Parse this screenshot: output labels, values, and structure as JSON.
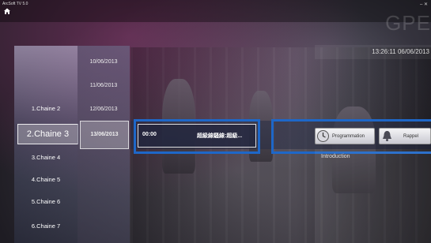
{
  "app": {
    "title": "ArcSoft TV 5.0",
    "brand": "GPE",
    "datetime": "13:26:11   06/06/2013"
  },
  "channels": [
    {
      "label": "1.Chaine 2"
    },
    {
      "label": "2.Chaine 3",
      "selected": true
    },
    {
      "label": "3.Chaine 4"
    },
    {
      "label": "4.Chaine 5"
    },
    {
      "label": "5.Chaine 6"
    },
    {
      "label": "6.Chaine 7"
    }
  ],
  "dates": [
    {
      "label": "10/06/2013"
    },
    {
      "label": "11/06/2013"
    },
    {
      "label": "12/06/2013"
    },
    {
      "label": "13/06/2013",
      "selected": true
    }
  ],
  "program": {
    "time": "00:00",
    "title": "超級線騷線:超級..."
  },
  "actions": {
    "programmation": "Programmation",
    "rappel": "Rappel"
  },
  "details": {
    "introduction": "Introduction"
  },
  "colors": {
    "highlight": "#1e67c8"
  },
  "icons": {
    "home": "home-icon",
    "clock": "clock-icon",
    "bell": "bell-icon"
  }
}
